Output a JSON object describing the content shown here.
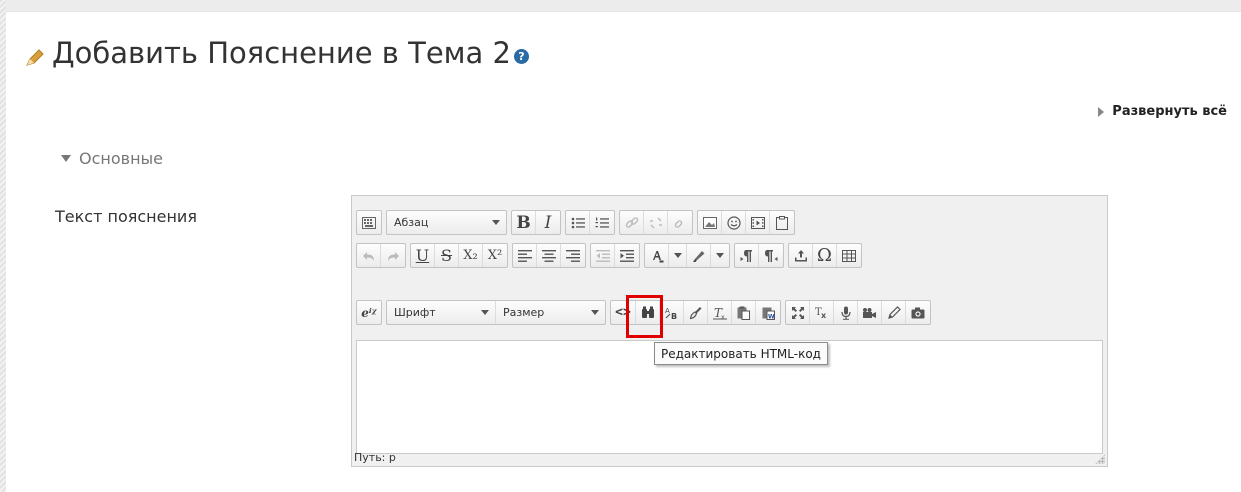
{
  "page": {
    "title": "Добавить Пояснение в Тема 2",
    "help_icon_glyph": "?",
    "expand_all": "Развернуть всё",
    "section_header": "Основные",
    "field_label": "Текст пояснения"
  },
  "editor": {
    "format_select": "Абзац",
    "font_select": "Шрифт",
    "size_select": "Размер",
    "path_status": "Путь: p",
    "tooltip": "Редактировать HTML-код",
    "glyphs": {
      "bold": "B",
      "italic": "I",
      "underline": "U",
      "strike": "S",
      "subscript": "X₂",
      "superscript": "X²",
      "omega": "Ω",
      "equation": "eⁱᵡ",
      "html": "<>"
    }
  },
  "colors": {
    "accent_highlight": "#e00000",
    "help_icon": "#2a6aa6"
  }
}
